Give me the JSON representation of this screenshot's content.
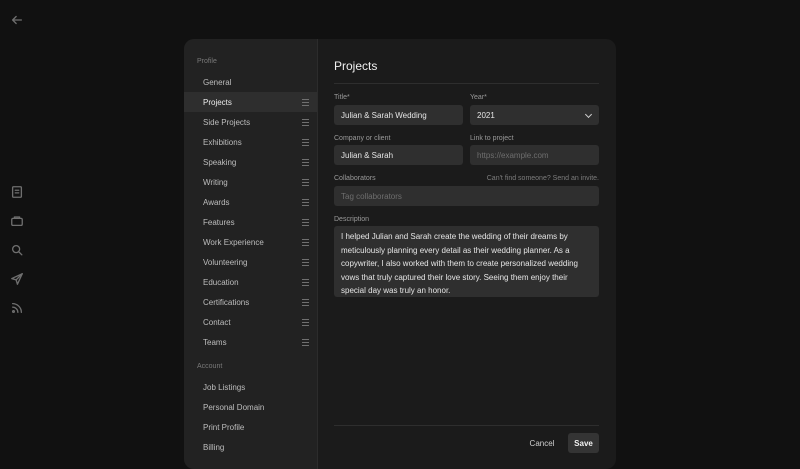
{
  "rail": {
    "icons": [
      "back-arrow-icon",
      "notebook-icon",
      "folder-icon",
      "search-icon",
      "send-icon",
      "rss-icon"
    ]
  },
  "sidebar": {
    "profile_heading": "Profile",
    "profile_items": [
      {
        "label": "General"
      },
      {
        "label": "Projects"
      },
      {
        "label": "Side Projects"
      },
      {
        "label": "Exhibitions"
      },
      {
        "label": "Speaking"
      },
      {
        "label": "Writing"
      },
      {
        "label": "Awards"
      },
      {
        "label": "Features"
      },
      {
        "label": "Work Experience"
      },
      {
        "label": "Volunteering"
      },
      {
        "label": "Education"
      },
      {
        "label": "Certifications"
      },
      {
        "label": "Contact"
      },
      {
        "label": "Teams"
      }
    ],
    "account_heading": "Account",
    "account_items": [
      {
        "label": "Job Listings"
      },
      {
        "label": "Personal Domain"
      },
      {
        "label": "Print Profile"
      },
      {
        "label": "Billing"
      }
    ]
  },
  "form": {
    "title": "Projects",
    "title_label": "Title*",
    "title_value": "Julian & Sarah Wedding",
    "year_label": "Year*",
    "year_value": "2021",
    "company_label": "Company or client",
    "company_value": "Julian & Sarah",
    "link_label": "Link to project",
    "link_placeholder": "https://example.com",
    "collaborators_label": "Collaborators",
    "collaborators_hint": "Can't find someone? Send an invite.",
    "collaborators_placeholder": "Tag collaborators",
    "description_label": "Description",
    "description_value": "I helped Julian and Sarah create the wedding of their dreams by meticulously planning every detail as their wedding planner. As a copywriter, I also worked with them to create personalized wedding vows that truly captured their love story. Seeing them enjoy their special day was truly an honor.",
    "cancel_label": "Cancel",
    "save_label": "Save"
  }
}
